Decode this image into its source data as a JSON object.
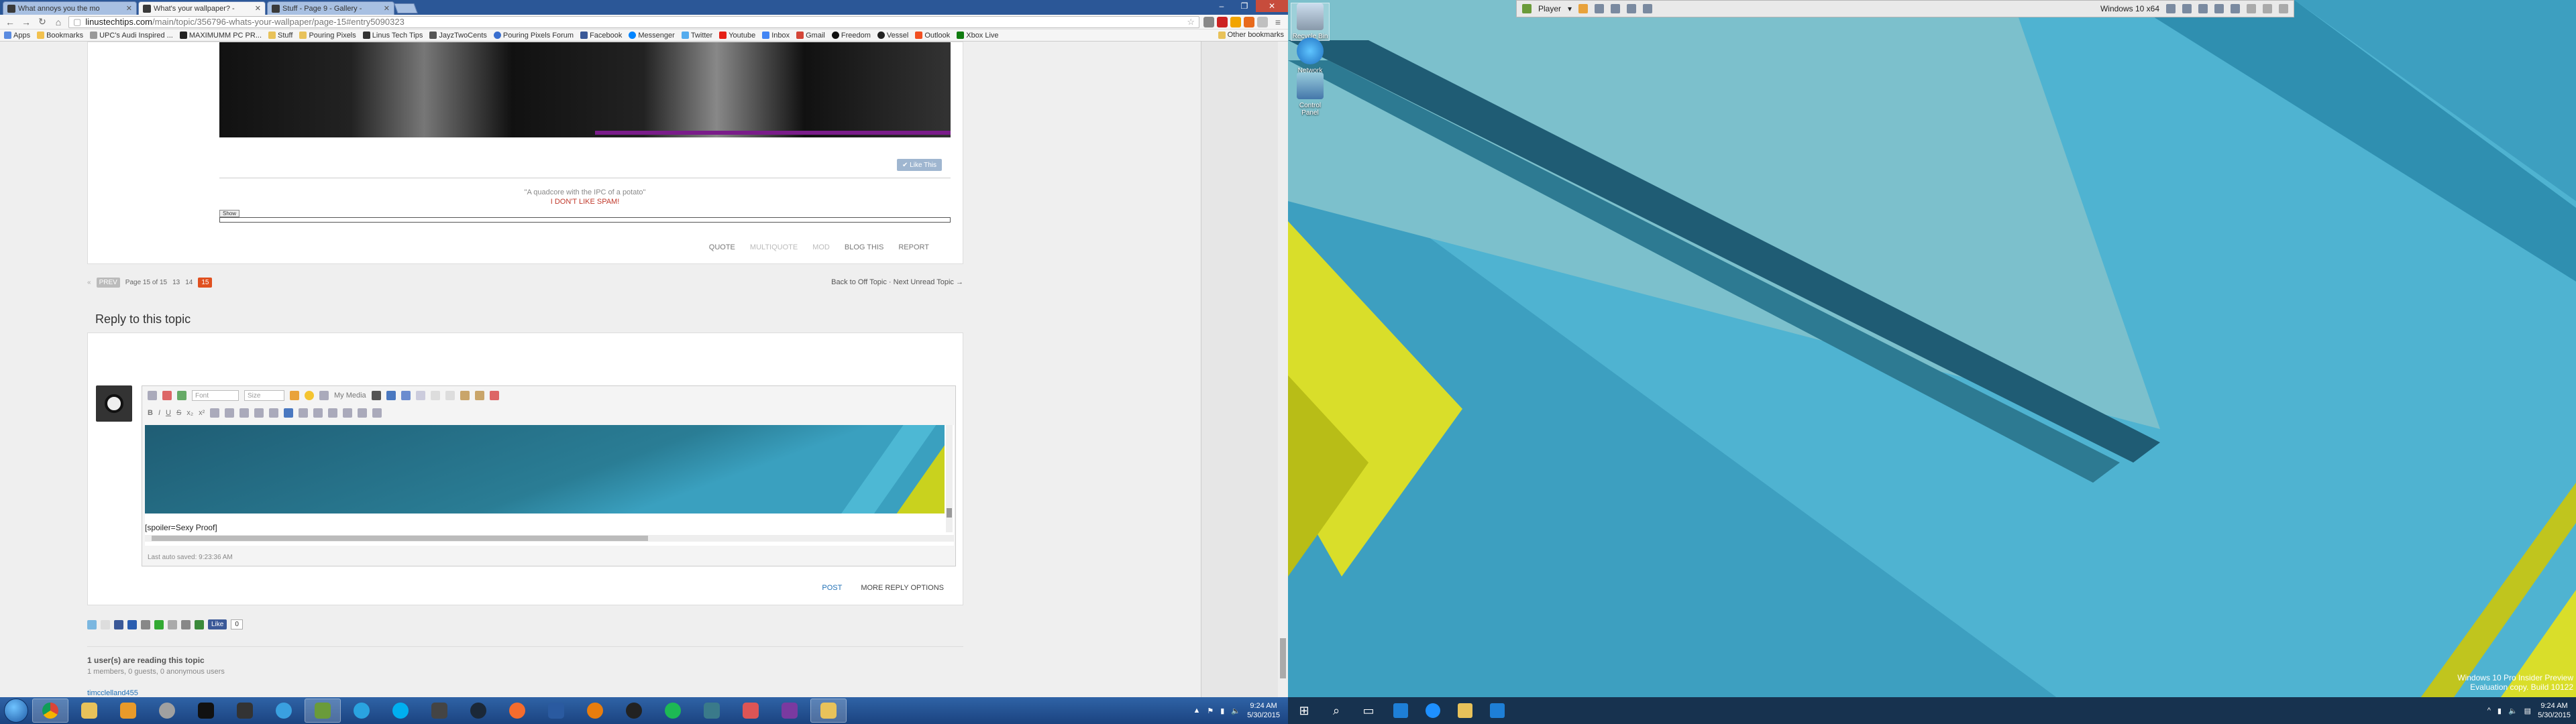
{
  "browser": {
    "tabs": [
      {
        "title": "What annoys you the mo"
      },
      {
        "title": "What's your wallpaper? - "
      },
      {
        "title": "Stuff - Page 9 - Gallery - "
      }
    ],
    "url_host": "linustechtips.com",
    "url_path": "/main/topic/356796-whats-your-wallpaper/page-15#entry5090323",
    "bookmarks": [
      "Apps",
      "Bookmarks",
      "UPC's Audi Inspired ...",
      "MAXIMUMM PC PR...",
      "Stuff",
      "Pouring Pixels",
      "Linus Tech Tips",
      "JayzTwoCents",
      "Pouring Pixels Forum",
      "Facebook",
      "Messenger",
      "Twitter",
      "Youtube",
      "Inbox",
      "Gmail",
      "Freedom",
      "Vessel",
      "Outlook",
      "Xbox Live"
    ],
    "other_bookmarks": "Other bookmarks"
  },
  "post": {
    "like_label": "Like This",
    "sig_quote": "\"A quadcore with the IPC of a potato\"",
    "sig_red": "I DON'T LIKE SPAM!",
    "show_label": "Show",
    "actions": {
      "quote": "QUOTE",
      "multiquote": "MULTIQUOTE",
      "mod": "MOD",
      "blog": "BLOG THIS",
      "report": "REPORT"
    }
  },
  "pager": {
    "prev": "PREV",
    "page_of": "Page 15 of 15",
    "pages": [
      "13",
      "14"
    ],
    "current": "15",
    "nav": "Back to Off Topic · Next Unread Topic →"
  },
  "reply": {
    "title": "Reply to this topic",
    "font_placeholder": "Font",
    "size_placeholder": "Size",
    "my_media": "My Media",
    "editor_text": "[spoiler=Sexy Proof]",
    "autosave": "Last auto saved: 9:23:36 AM",
    "post_label": "POST",
    "more_label": "MORE REPLY OPTIONS"
  },
  "share": {
    "fb_like": "Like",
    "fb_count": "0"
  },
  "readers": {
    "headline": "1 user(s) are reading this topic",
    "detail": "1 members, 0 guests, 0 anonymous users",
    "user": "timcclelland455"
  },
  "host_clock": {
    "time": "9:24 AM",
    "date": "5/30/2015"
  },
  "vm": {
    "player_label": "Player",
    "vm_name": "Windows 10 x64",
    "desktop_icons": [
      "Recycle Bin",
      "Network",
      "Control Panel"
    ],
    "watermark_line1": "Windows 10 Pro Insider Preview",
    "watermark_line2": "Evaluation copy. Build 10122",
    "clock": {
      "time": "9:24 AM",
      "date": "5/30/2015"
    }
  },
  "colors": {
    "win7_taskbar": "#2f63a6",
    "win10_taskbar": "#17324f",
    "accent_orange": "#e0501f",
    "wallpaper_teal": "#3d9fc0",
    "wallpaper_yellow": "#c9d21e"
  }
}
